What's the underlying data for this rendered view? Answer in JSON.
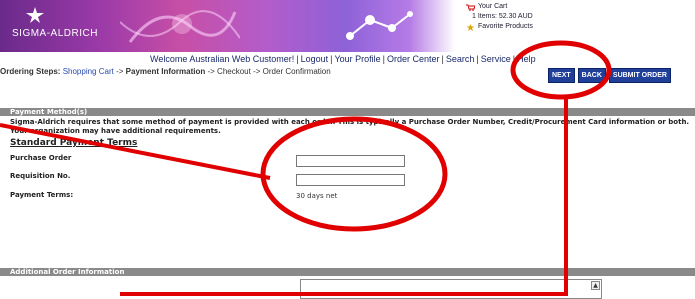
{
  "brand": {
    "logo_text": "SIGMA-ALDRICH"
  },
  "cart": {
    "label": "Your Cart",
    "summary": "1 Items: 52.30 AUD",
    "favorites": "Favorite Products"
  },
  "nav": {
    "welcome": "Welcome Australian Web Customer!",
    "links": [
      "Logout",
      "Your Profile",
      "Order Center",
      "Search",
      "Service",
      "Help"
    ]
  },
  "steps": {
    "prefix": "Ordering Steps:",
    "cart": "Shopping Cart",
    "arrow": "->",
    "current": "Payment Information",
    "checkout": "Checkout",
    "confirm": "Order Confirmation"
  },
  "buttons": {
    "next": "NEXT",
    "back": "BACK",
    "submit": "SUBMIT ORDER"
  },
  "payment": {
    "header": "Payment Method(s)",
    "description": "Sigma-Aldrich requires that some method of payment is provided with each order. This is typically a Purchase Order Number, Credit/Procurement Card information or both. Your organization may have additional requirements.",
    "standard_terms": "Standard Payment Terms",
    "po_label": "Purchase Order",
    "po_value": "",
    "req_label": "Requisition No.",
    "req_value": "",
    "terms_label": "Payment Terms:",
    "terms_value": "30 days net"
  },
  "additional": {
    "header": "Additional Order Information"
  },
  "colors": {
    "nav_blue": "#1a2a6c",
    "button_blue": "#1f3f99",
    "annotation_red": "#e00000",
    "section_gray": "#8a8a8a"
  }
}
